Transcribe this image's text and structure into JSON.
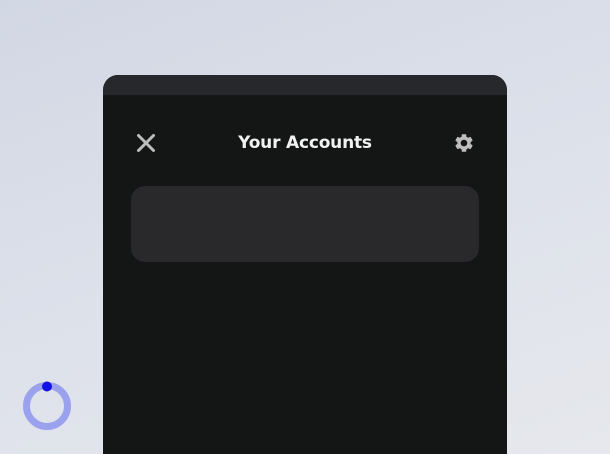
{
  "header": {
    "title": "Your Accounts"
  },
  "icons": {
    "close": "close-icon",
    "settings": "gear-icon",
    "loading": "loading-spinner-icon"
  },
  "colors": {
    "panel_background": "#141616",
    "card_background": "#29292c",
    "title_text": "#f1f1f1",
    "icon": "#bdbdbd",
    "spinner_track": "#9aa2ee",
    "spinner_dot": "#1212e6"
  }
}
